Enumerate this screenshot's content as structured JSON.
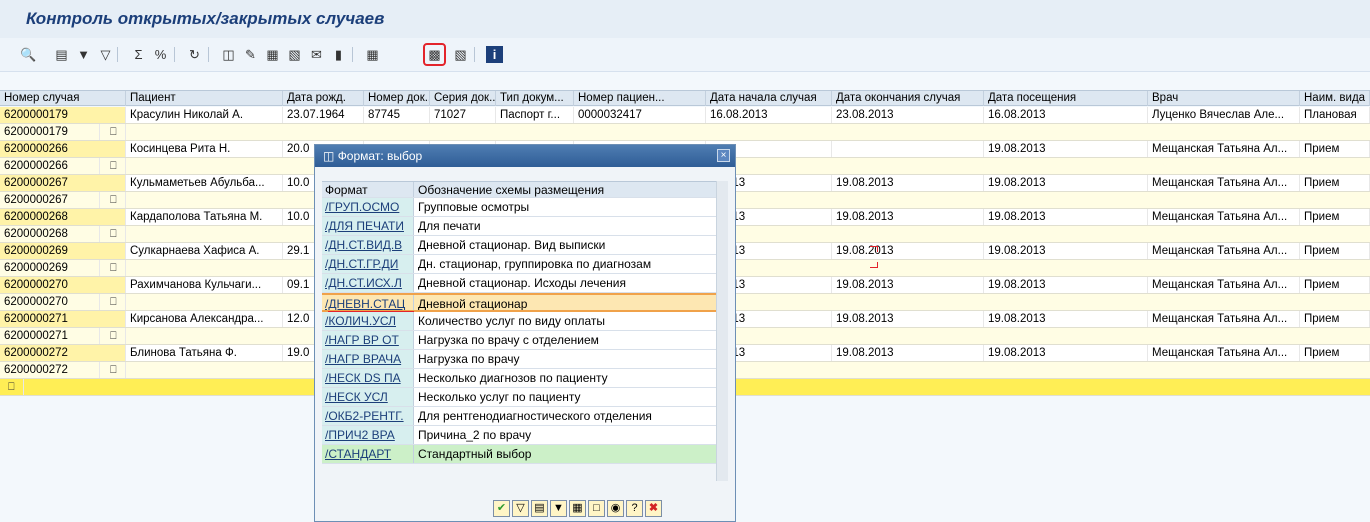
{
  "window": {
    "title": "Контроль открытых/закрытых случаев"
  },
  "toolbar": {
    "icons": [
      "details-icon",
      "print-icon",
      "filter-icon",
      "filter-delete-icon",
      "sum-icon",
      "subtotal-icon",
      "refresh-icon",
      "export-icon",
      "word-icon",
      "excel-icon",
      "spreadsheet-icon",
      "mail-icon",
      "graphic-icon",
      "layout-change-icon",
      "layout-select-icon",
      "layout-save-icon",
      "info-icon"
    ]
  },
  "table": {
    "columns": [
      "Номер случая",
      "Пациент",
      "Дата рожд.",
      "Номер док...",
      "Серия док...",
      "Тип докум...",
      "Номер пациен...",
      "Дата начала случая",
      "Дата окончания случая",
      "Дата посещения",
      "Врач",
      "Наим. вида"
    ],
    "rows": [
      {
        "type": "main",
        "c": [
          "6200000179",
          "Красулин Николай А.",
          "23.07.1964",
          "87745",
          "71027",
          "Паспорт г...",
          "0000032417",
          "16.08.2013",
          "23.08.2013",
          "16.08.2013",
          "Луценко Вячеслав Але...",
          "Плановая"
        ]
      },
      {
        "type": "sub",
        "c": [
          "6200000179"
        ]
      },
      {
        "type": "main",
        "c": [
          "6200000266",
          "Косинцева Рита Н.",
          "20.0",
          "",
          "",
          "",
          "",
          "",
          "",
          "19.08.2013",
          "Мещанская Татьяна Ал...",
          "Прием"
        ]
      },
      {
        "type": "sub",
        "c": [
          "6200000266"
        ]
      },
      {
        "type": "main",
        "c": [
          "6200000267",
          "Кульмаметьев Абульба...",
          "10.0",
          "",
          "",
          "",
          "",
          "8.2013",
          "19.08.2013",
          "19.08.2013",
          "Мещанская Татьяна Ал...",
          "Прием"
        ]
      },
      {
        "type": "sub",
        "c": [
          "6200000267"
        ]
      },
      {
        "type": "main",
        "c": [
          "6200000268",
          "Кардаполова Татьяна М.",
          "10.0",
          "",
          "",
          "",
          "",
          "8.2013",
          "19.08.2013",
          "19.08.2013",
          "Мещанская Татьяна Ал...",
          "Прием"
        ]
      },
      {
        "type": "sub",
        "c": [
          "6200000268"
        ]
      },
      {
        "type": "main",
        "c": [
          "6200000269",
          "Сулкарнаева Хафиса А.",
          "29.1",
          "",
          "",
          "",
          "",
          "8.2013",
          "19.08.2013",
          "19.08.2013",
          "Мещанская Татьяна Ал...",
          "Прием"
        ]
      },
      {
        "type": "sub",
        "c": [
          "6200000269"
        ]
      },
      {
        "type": "main",
        "c": [
          "6200000270",
          "Рахимчанова Кульчаги...",
          "09.1",
          "",
          "",
          "",
          "",
          "8.2013",
          "19.08.2013",
          "19.08.2013",
          "Мещанская Татьяна Ал...",
          "Прием"
        ]
      },
      {
        "type": "sub",
        "c": [
          "6200000270"
        ]
      },
      {
        "type": "main",
        "c": [
          "6200000271",
          "Кирсанова Александра...",
          "12.0",
          "",
          "",
          "",
          "",
          "8.2013",
          "19.08.2013",
          "19.08.2013",
          "Мещанская Татьяна Ал...",
          "Прием"
        ]
      },
      {
        "type": "sub",
        "c": [
          "6200000271"
        ]
      },
      {
        "type": "main",
        "c": [
          "6200000272",
          "Блинова Татьяна Ф.",
          "19.0",
          "",
          "",
          "",
          "",
          "8.2013",
          "19.08.2013",
          "19.08.2013",
          "Мещанская Татьяна Ал...",
          "Прием"
        ]
      },
      {
        "type": "sub",
        "c": [
          "6200000272"
        ]
      },
      {
        "type": "tot",
        "c": [
          ""
        ]
      }
    ]
  },
  "dialog": {
    "title": "Формат: выбор",
    "close": "×",
    "header": {
      "col1": "Формат",
      "col2": "Обозначение схемы размещения"
    },
    "items": [
      {
        "code": "/ГРУП.ОСМО",
        "name": "Групповые осмотры"
      },
      {
        "code": "/ДЛЯ ПЕЧАТИ",
        "name": "Для печати"
      },
      {
        "code": "/ДН.СТ.ВИД.В",
        "name": "Дневной стационар. Вид выписки"
      },
      {
        "code": "/ДН.СТ.ГР.ДИ",
        "name": "Дн. стационар, группировка по диагнозам"
      },
      {
        "code": "/ДН.СТ.ИСХ.Л",
        "name": "Дневной стационар. Исходы лечения"
      },
      {
        "code": "/ДНЕВН.СТАЦ",
        "name": "Дневной стационар",
        "selected": true
      },
      {
        "code": "/КОЛИЧ.УСЛ",
        "name": "Количество услуг по виду оплаты"
      },
      {
        "code": "/НАГР ВР ОТ",
        "name": "Нагрузка по врачу с отделением"
      },
      {
        "code": "/НАГР ВРАЧА",
        "name": "Нагрузка по врачу"
      },
      {
        "code": "/НЕСК DS ПА",
        "name": "Несколько диагнозов по пациенту"
      },
      {
        "code": "/НЕСК УСЛ",
        "name": "Несколько услуг по пациенту"
      },
      {
        "code": "/ОКБ2-РЕНТГ.",
        "name": "Для рентгенодиагностического отделения"
      },
      {
        "code": "/ПРИЧ2 ВРА",
        "name": "Причина_2 по врачу"
      },
      {
        "code": "/СТАНДАРТ",
        "name": "Стандартный выбор",
        "standard": true
      }
    ],
    "buttons": [
      "ok-icon",
      "filter-icon",
      "print-icon",
      "sort-icon",
      "table-icon",
      "details-icon",
      "find-icon",
      "help-icon",
      "cancel-icon"
    ]
  }
}
